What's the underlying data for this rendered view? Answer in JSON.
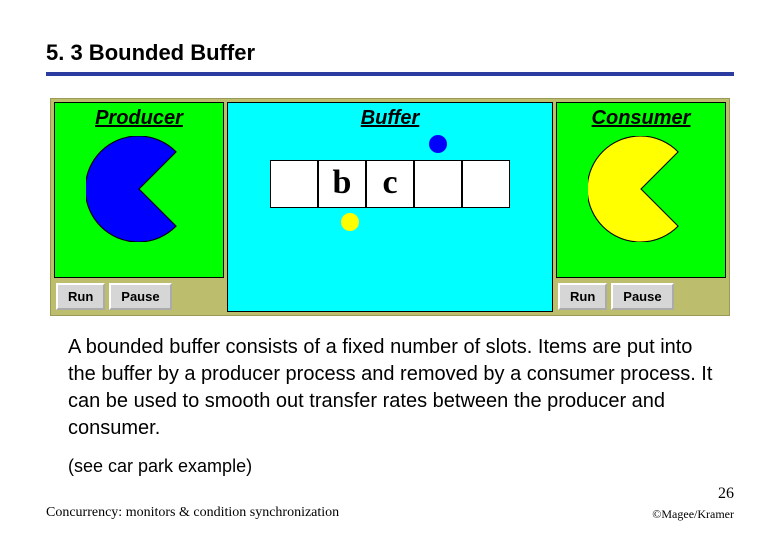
{
  "title": "5. 3  Bounded Buffer",
  "applet": {
    "producer": {
      "label": "Producer",
      "color": "#0000ff",
      "run": "Run",
      "pause": "Pause"
    },
    "buffer": {
      "label": "Buffer",
      "slots": [
        "",
        "b",
        "c",
        "",
        ""
      ],
      "top_dot_color": "#0000ff",
      "bottom_dot_color": "#ffff00"
    },
    "consumer": {
      "label": "Consumer",
      "color": "#ffff00",
      "run": "Run",
      "pause": "Pause"
    }
  },
  "body": "A bounded buffer consists of a fixed number of slots. Items are put into the buffer by a producer process and removed by a consumer process. It can be used to smooth out transfer rates between the producer and consumer.",
  "see_also": "(see car park example)",
  "footer": {
    "left": "Concurrency: monitors & condition synchronization",
    "page": "26",
    "copy": "©Magee/Kramer"
  }
}
